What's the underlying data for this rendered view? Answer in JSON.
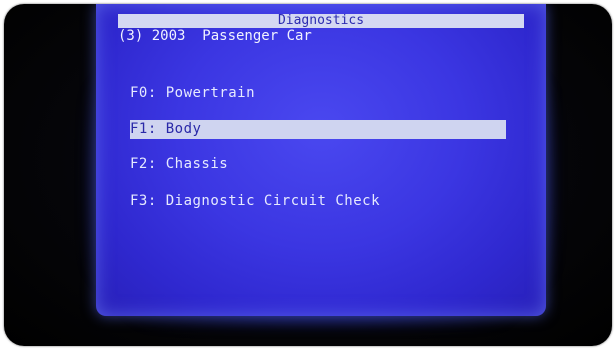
{
  "screen": {
    "title": "Diagnostics",
    "subtitle": "(3) 2003  Passenger Car",
    "menu": [
      {
        "label": "F0: Powertrain",
        "selected": false
      },
      {
        "label": "F1: Body",
        "selected": true
      },
      {
        "label": "F2: Chassis",
        "selected": false
      },
      {
        "label": "F3: Diagnostic Circuit Check",
        "selected": false
      }
    ]
  },
  "colors": {
    "screen_background": "#3b36e2",
    "highlight": "#cfd4f0",
    "text": "#e6eaff",
    "highlight_text": "#2a29a8"
  }
}
